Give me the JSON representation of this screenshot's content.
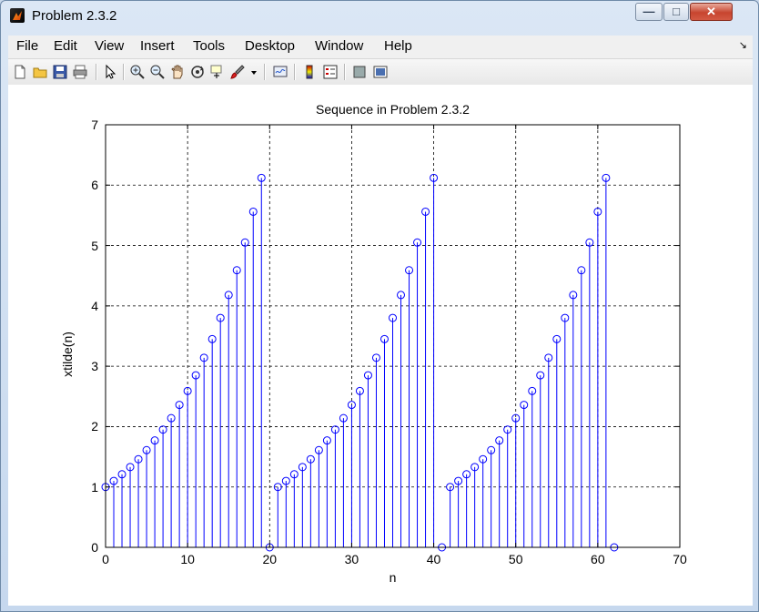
{
  "window": {
    "title": "Problem 2.3.2",
    "minimize_glyph": "—",
    "maximize_glyph": "□",
    "close_glyph": "✕"
  },
  "menu": {
    "items": [
      "File",
      "Edit",
      "View",
      "Insert",
      "Tools",
      "Desktop",
      "Window",
      "Help"
    ],
    "overflow_glyph": "↘"
  },
  "toolbar": {
    "icons": [
      "new-figure-icon",
      "open-file-icon",
      "save-icon",
      "print-icon",
      "pointer-arrow-icon",
      "zoom-in-icon",
      "zoom-out-icon",
      "pan-hand-icon",
      "rotate-3d-icon",
      "data-cursor-icon",
      "brush-icon",
      "brush-dropdown-icon",
      "link-plot-icon",
      "colorbar-icon",
      "legend-icon",
      "hide-plot-tools-icon",
      "show-plot-tools-icon"
    ]
  },
  "colors": {
    "stem": "#0000ff",
    "grid": "#000000",
    "axes_bg": "#ffffff"
  },
  "chart_data": {
    "type": "stem",
    "title": "Sequence in Problem 2.3.2",
    "xlabel": "n",
    "ylabel": "xtilde(n)",
    "xlim": [
      0,
      70
    ],
    "ylim": [
      0,
      7
    ],
    "xticks": [
      "0",
      "10",
      "20",
      "30",
      "40",
      "50",
      "60",
      "70"
    ],
    "yticks": [
      "0",
      "1",
      "2",
      "3",
      "4",
      "5",
      "6",
      "7"
    ],
    "grid": true,
    "x": [
      0,
      1,
      2,
      3,
      4,
      5,
      6,
      7,
      8,
      9,
      10,
      11,
      12,
      13,
      14,
      15,
      16,
      17,
      18,
      19,
      20,
      21,
      22,
      23,
      24,
      25,
      26,
      27,
      28,
      29,
      30,
      31,
      32,
      33,
      34,
      35,
      36,
      37,
      38,
      39,
      40,
      41,
      42,
      43,
      44,
      45,
      46,
      47,
      48,
      49,
      50,
      51,
      52,
      53,
      54,
      55,
      56,
      57,
      58,
      59,
      60,
      61,
      62
    ],
    "y": [
      1.0,
      1.1,
      1.21,
      1.33,
      1.46,
      1.61,
      1.77,
      1.95,
      2.14,
      2.36,
      2.59,
      2.85,
      3.14,
      3.45,
      3.8,
      4.18,
      4.59,
      5.05,
      5.56,
      6.12,
      0,
      1.0,
      1.1,
      1.21,
      1.33,
      1.46,
      1.61,
      1.77,
      1.95,
      2.14,
      2.36,
      2.59,
      2.85,
      3.14,
      3.45,
      3.8,
      4.18,
      4.59,
      5.05,
      5.56,
      6.12,
      0,
      1.0,
      1.1,
      1.21,
      1.33,
      1.46,
      1.61,
      1.77,
      1.95,
      2.14,
      2.36,
      2.59,
      2.85,
      3.14,
      3.45,
      3.8,
      4.18,
      4.59,
      5.05,
      5.56,
      6.12,
      0
    ]
  }
}
